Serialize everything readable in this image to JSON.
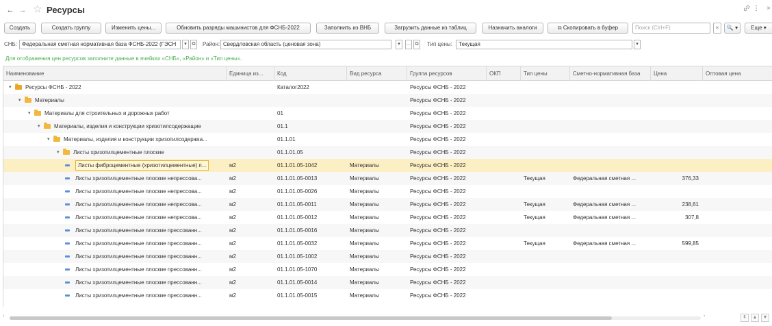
{
  "window": {
    "title": "Ресурсы",
    "back_icon": "←",
    "forward_icon": "→",
    "star_icon": "☆",
    "link_icon": "🔗",
    "more_icon": "⋮",
    "close_icon": "×"
  },
  "toolbar": {
    "create": "Создать",
    "create_group": "Создать группу",
    "change_prices": "Изменить цены...",
    "update_ranks": "Обновить разряды машинистов для ФСНБ-2022",
    "fill_vnb": "Заполнить из ВНБ",
    "load_tables": "Загрузить данные из таблиц",
    "assign_analogs": "Назначить аналоги",
    "copy_buffer": "Скопировать в буфер",
    "search_placeholder": "Поиск (Ctrl+F)",
    "search_clear": "×",
    "search_go": "🔍 ▾",
    "more": "Еще ▾"
  },
  "filter": {
    "snb_label": "СНБ:",
    "snb_value": "Федеральная сметная нормативная база ФСНБ-2022 (ГЭСН",
    "region_label": "Район:",
    "region_value": "Свердловская область (ценовая зона)",
    "price_type_label": "Тип цены:",
    "price_type_value": "Текущая",
    "dropdown_glyph": "▾",
    "open_glyph": "⧉",
    "dots_glyph": "..."
  },
  "hint": "Для отображения цен ресурсов заполните данные в ячейках «СНБ», «Район» и «Тип цены».",
  "table": {
    "columns": [
      "Наименование",
      "Единица из...",
      "Код",
      "Вид ресурса",
      "Группа ресурсов",
      "ОКП",
      "Тип цены",
      "Сметно-нормативная база",
      "Цена",
      "Оптовая цена"
    ],
    "rows": [
      {
        "kind": "group",
        "name": "Ресурсы ФСНБ - 2022",
        "unit": "",
        "code": "Каталог2022",
        "type": "",
        "group": "Ресурсы ФСНБ - 2022",
        "okp": "",
        "price_type": "",
        "base": "",
        "price": "",
        "wholesale": ""
      },
      {
        "kind": "group",
        "name": "Материалы",
        "unit": "",
        "code": "",
        "type": "",
        "group": "Ресурсы ФСНБ - 2022",
        "okp": "",
        "price_type": "",
        "base": "",
        "price": "",
        "wholesale": ""
      },
      {
        "kind": "group",
        "name": "Материалы для строительных и дорожных работ",
        "unit": "",
        "code": "01",
        "type": "",
        "group": "Ресурсы ФСНБ - 2022",
        "okp": "",
        "price_type": "",
        "base": "",
        "price": "",
        "wholesale": ""
      },
      {
        "kind": "group",
        "name": "Материалы, изделия и конструкции хризотилсодержащие",
        "unit": "",
        "code": "01.1",
        "type": "",
        "group": "Ресурсы ФСНБ - 2022",
        "okp": "",
        "price_type": "",
        "base": "",
        "price": "",
        "wholesale": ""
      },
      {
        "kind": "group",
        "name": "Материалы, изделия и конструкции хризотилсодержка...",
        "unit": "",
        "code": "01.1.01",
        "type": "",
        "group": "Ресурсы ФСНБ - 2022",
        "okp": "",
        "price_type": "",
        "base": "",
        "price": "",
        "wholesale": ""
      },
      {
        "kind": "group",
        "name": "Листы хризотилцементные плоские",
        "unit": "",
        "code": "01.1.01.05",
        "type": "",
        "group": "Ресурсы ФСНБ - 2022",
        "okp": "",
        "price_type": "",
        "base": "",
        "price": "",
        "wholesale": ""
      },
      {
        "kind": "item",
        "name": "Листы фиброцементные (хризотилцементные) п...",
        "unit": "м2",
        "code": "01.1.01.05-1042",
        "type": "Материалы",
        "group": "Ресурсы ФСНБ - 2022",
        "okp": "",
        "price_type": "",
        "base": "",
        "price": "",
        "wholesale": ""
      },
      {
        "kind": "item",
        "name": "Листы хризотилцементные плоские непрессова...",
        "unit": "м2",
        "code": "01.1.01.05-0013",
        "type": "Материалы",
        "group": "Ресурсы ФСНБ - 2022",
        "okp": "",
        "price_type": "Текущая",
        "base": "Федеральная сметная ...",
        "price": "376,33",
        "wholesale": ""
      },
      {
        "kind": "item",
        "name": "Листы хризотилцементные плоские непрессова...",
        "unit": "м2",
        "code": "01.1.01.05-0026",
        "type": "Материалы",
        "group": "Ресурсы ФСНБ - 2022",
        "okp": "",
        "price_type": "",
        "base": "",
        "price": "",
        "wholesale": ""
      },
      {
        "kind": "item",
        "name": "Листы хризотилцементные плоские непрессова...",
        "unit": "м2",
        "code": "01.1.01.05-0011",
        "type": "Материалы",
        "group": "Ресурсы ФСНБ - 2022",
        "okp": "",
        "price_type": "Текущая",
        "base": "Федеральная сметная ...",
        "price": "238,61",
        "wholesale": ""
      },
      {
        "kind": "item",
        "name": "Листы хризотилцементные плоские непрессова...",
        "unit": "м2",
        "code": "01.1.01.05-0012",
        "type": "Материалы",
        "group": "Ресурсы ФСНБ - 2022",
        "okp": "",
        "price_type": "Текущая",
        "base": "Федеральная сметная ...",
        "price": "307,8",
        "wholesale": ""
      },
      {
        "kind": "item",
        "name": "Листы хризотилцементные плоские прессованн...",
        "unit": "м2",
        "code": "01.1.01.05-0016",
        "type": "Материалы",
        "group": "Ресурсы ФСНБ - 2022",
        "okp": "",
        "price_type": "",
        "base": "",
        "price": "",
        "wholesale": ""
      },
      {
        "kind": "item",
        "name": "Листы хризотилцементные плоские прессованн...",
        "unit": "м2",
        "code": "01.1.01.05-0032",
        "type": "Материалы",
        "group": "Ресурсы ФСНБ - 2022",
        "okp": "",
        "price_type": "Текущая",
        "base": "Федеральная сметная ...",
        "price": "599,85",
        "wholesale": ""
      },
      {
        "kind": "item",
        "name": "Листы хризотилцементные плоские прессованн...",
        "unit": "м2",
        "code": "01.1.01.05-1002",
        "type": "Материалы",
        "group": "Ресурсы ФСНБ - 2022",
        "okp": "",
        "price_type": "",
        "base": "",
        "price": "",
        "wholesale": ""
      },
      {
        "kind": "item",
        "name": "Листы хризотилцементные плоские прессованн...",
        "unit": "м2",
        "code": "01.1.01.05-1070",
        "type": "Материалы",
        "group": "Ресурсы ФСНБ - 2022",
        "okp": "",
        "price_type": "",
        "base": "",
        "price": "",
        "wholesale": ""
      },
      {
        "kind": "item",
        "name": "Листы хризотилцементные плоские прессованн...",
        "unit": "м2",
        "code": "01.1.01.05-0014",
        "type": "Материалы",
        "group": "Ресурсы ФСНБ - 2022",
        "okp": "",
        "price_type": "",
        "base": "",
        "price": "",
        "wholesale": ""
      },
      {
        "kind": "item",
        "name": "Листы хризотилцементные плоские прессованн...",
        "unit": "м2",
        "code": "01.1.01.05-0015",
        "type": "Материалы",
        "group": "Ресурсы ФСНБ - 2022",
        "okp": "",
        "price_type": "",
        "base": "",
        "price": "",
        "wholesale": ""
      }
    ]
  },
  "scroll": {
    "left_icon": "‹",
    "right_icon": "›",
    "nav_first": "⇞",
    "nav_up": "▲",
    "nav_down": "▼"
  }
}
